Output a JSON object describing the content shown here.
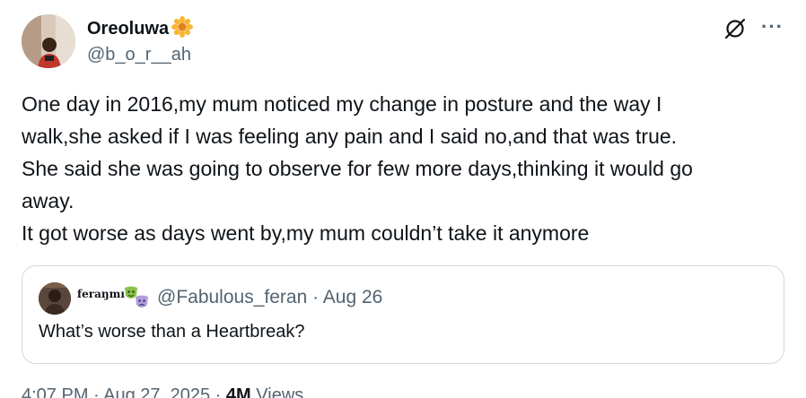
{
  "author": {
    "display_name": "Oreoluwa",
    "handle": "@b_o_r__ah",
    "name_emoji": "sunflower-icon"
  },
  "tweet": {
    "lines": [
      "One day in 2016,my mum noticed my change in posture and the way I",
      "walk,she asked if I was feeling any pain and I said no,and that was true.",
      "She said she was going to observe for few more days,thinking it would go",
      "away.",
      "It got worse as days went by,my mum couldn’t take it anymore"
    ]
  },
  "quoted_tweet": {
    "display_name": "feraŋmı",
    "name_emojis": [
      "comedy-mask-icon",
      "tragedy-mask-icon"
    ],
    "meta": "@Fabulous_feran · Aug 26",
    "text": "What’s worse than a Heartbreak?"
  },
  "footer": {
    "time_date": "4:07 PM · Aug 27, 2025 · ",
    "views_count": "4M",
    "views_label": " Views"
  },
  "colors": {
    "text": "#0f1419",
    "secondary": "#536471",
    "border": "#cfd9de"
  }
}
